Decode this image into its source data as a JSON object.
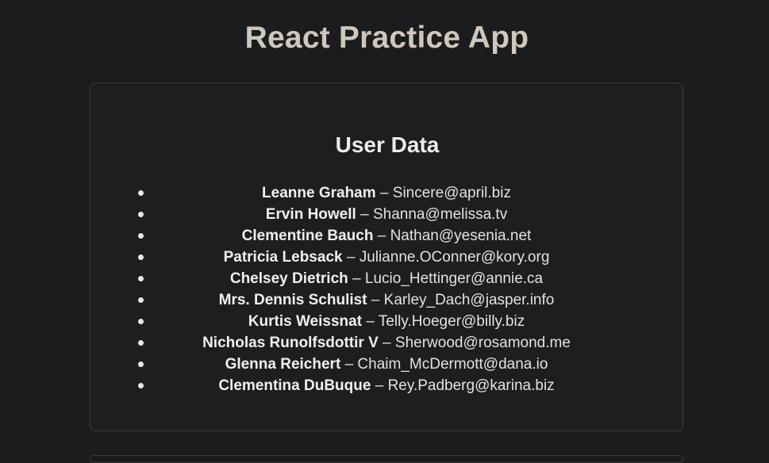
{
  "app": {
    "title": "React Practice App"
  },
  "user_card": {
    "title": "User Data",
    "separator": "–",
    "users": [
      {
        "name": "Leanne Graham",
        "email": "Sincere@april.biz"
      },
      {
        "name": "Ervin Howell",
        "email": "Shanna@melissa.tv"
      },
      {
        "name": "Clementine Bauch",
        "email": "Nathan@yesenia.net"
      },
      {
        "name": "Patricia Lebsack",
        "email": "Julianne.OConner@kory.org"
      },
      {
        "name": "Chelsey Dietrich",
        "email": "Lucio_Hettinger@annie.ca"
      },
      {
        "name": "Mrs. Dennis Schulist",
        "email": "Karley_Dach@jasper.info"
      },
      {
        "name": "Kurtis Weissnat",
        "email": "Telly.Hoeger@billy.biz"
      },
      {
        "name": "Nicholas Runolfsdottir V",
        "email": "Sherwood@rosamond.me"
      },
      {
        "name": "Glenna Reichert",
        "email": "Chaim_McDermott@dana.io"
      },
      {
        "name": "Clementina DuBuque",
        "email": "Rey.Padberg@karina.biz"
      }
    ]
  }
}
